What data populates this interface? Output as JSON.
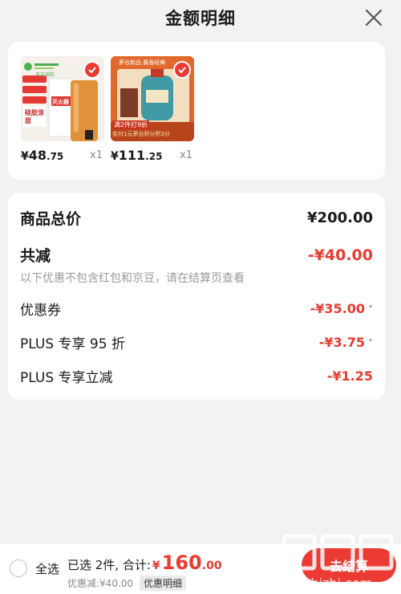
{
  "header": {
    "title": "金额明细"
  },
  "products": [
    {
      "brand": "天灾消防",
      "lines": [
        "灭火器",
        "硅胶涂层"
      ],
      "price_yen": "¥",
      "price_int": "48",
      "price_dec": ".75",
      "qty": "x1"
    },
    {
      "banner": "茅台新品 酱香经典",
      "badge": "满2件打9折",
      "promo": "实付1元茅台积分积3分",
      "price_yen": "¥",
      "price_int": "111",
      "price_dec": ".25",
      "qty": "x1"
    }
  ],
  "details": {
    "total_label": "商品总价",
    "total_value": "¥200.00",
    "reduce_label": "共减",
    "reduce_value": "-¥40.00",
    "note": "以下优惠不包含红包和京豆，请在结算页查看",
    "items": [
      {
        "label": "优惠券",
        "value": "-¥35.00",
        "chevron": "˅"
      },
      {
        "label": "PLUS 专享 95 折",
        "value": "-¥3.75",
        "chevron": "˅"
      },
      {
        "label": "PLUS 专享立减",
        "value": "-¥1.25",
        "chevron": ""
      }
    ]
  },
  "bottom": {
    "select_all": "全选",
    "selected_text": "已选 2件, 合计:",
    "rmb": "¥",
    "total_int": "160",
    "total_dec": ".00",
    "discount_text": "优惠减:¥40.00",
    "detail_button": "优惠明细",
    "checkout": "去结算"
  },
  "colors": {
    "accent": "#ec3a35",
    "price_red": "#e93b2f",
    "bg": "#f2f2f2"
  }
}
